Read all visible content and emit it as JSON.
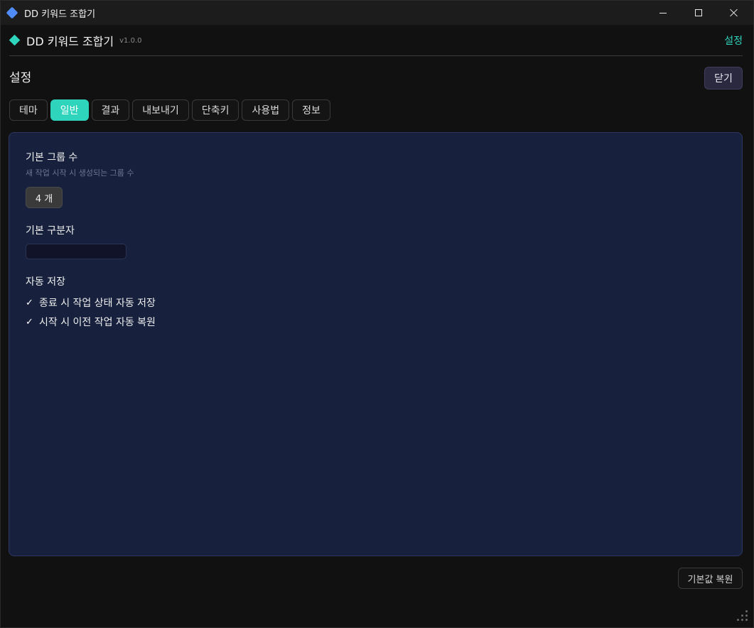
{
  "window": {
    "title": "DD 키워드 조합기",
    "icon": "diamond-icon",
    "accent": "#2fd4bd"
  },
  "header": {
    "app_name": "DD 키워드 조합기",
    "version": "v1.0.0",
    "settings_label": "설정"
  },
  "page": {
    "title": "설정",
    "close_label": "닫기"
  },
  "tabs": [
    {
      "label": "테마",
      "active": false
    },
    {
      "label": "일반",
      "active": true
    },
    {
      "label": "결과",
      "active": false
    },
    {
      "label": "내보내기",
      "active": false
    },
    {
      "label": "단축키",
      "active": false
    },
    {
      "label": "사용법",
      "active": false
    },
    {
      "label": "정보",
      "active": false
    }
  ],
  "general": {
    "group_count_label": "기본 그룹 수",
    "group_count_desc": "새 작업 시작 시 생성되는 그룹 수",
    "group_count_value": "4 개",
    "separator_label": "기본 구분자",
    "separator_value": "",
    "autosave_label": "자동 저장",
    "autosave_options": [
      {
        "label": "종료 시 작업 상태 자동 저장",
        "checked": true
      },
      {
        "label": "시작 시 이전 작업 자동 복원",
        "checked": true
      }
    ]
  },
  "footer": {
    "reset_label": "기본값 복원"
  }
}
